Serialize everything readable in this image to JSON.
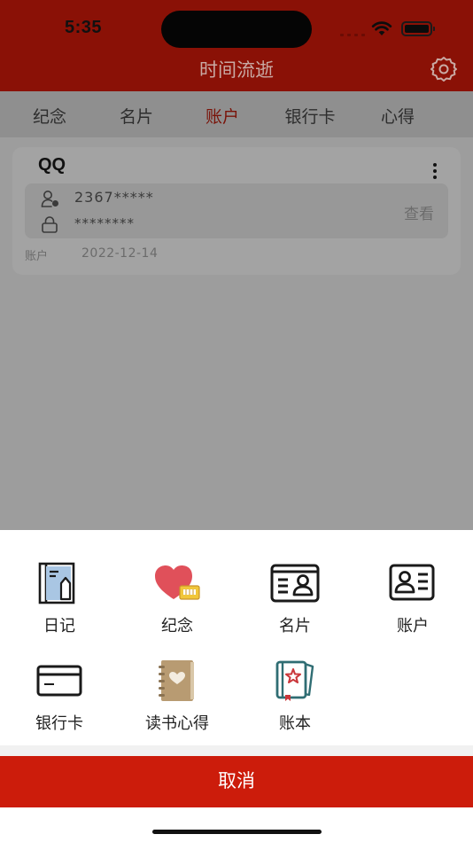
{
  "status_bar": {
    "time": "5:35"
  },
  "nav": {
    "title": "时间流逝",
    "icons": {
      "settings": "gear-icon"
    }
  },
  "tabs": [
    {
      "label": "纪念",
      "active": false
    },
    {
      "label": "名片",
      "active": false
    },
    {
      "label": "账户",
      "active": true
    },
    {
      "label": "银行卡",
      "active": false
    },
    {
      "label": "心得",
      "active": false
    }
  ],
  "account_card": {
    "title": "QQ",
    "username": "2367*****",
    "password": "********",
    "view_label": "查看",
    "type_label": "账户",
    "date": "2022-12-14"
  },
  "sheet": {
    "items": [
      {
        "label": "日记",
        "icon": "diary-icon"
      },
      {
        "label": "纪念",
        "icon": "heart-gift-icon"
      },
      {
        "label": "名片",
        "icon": "business-card-icon"
      },
      {
        "label": "账户",
        "icon": "account-card-icon"
      },
      {
        "label": "银行卡",
        "icon": "bank-card-icon"
      },
      {
        "label": "读书心得",
        "icon": "notebook-heart-icon"
      },
      {
        "label": "账本",
        "icon": "ledger-icon"
      }
    ],
    "cancel_label": "取消"
  },
  "colors": {
    "nav_bar": "#8a1106",
    "active_tab": "#7a1309",
    "cancel_button": "#cc1c0b",
    "sheet_background": "#ffffff"
  }
}
